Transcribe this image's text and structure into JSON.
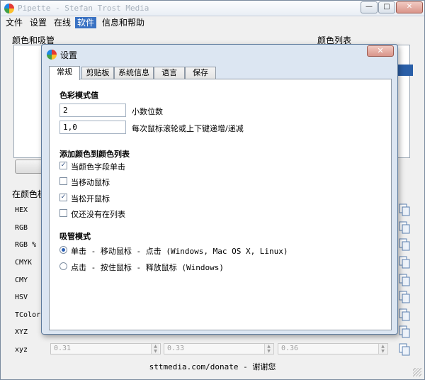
{
  "window": {
    "title": "Pipette - Stefan Trost Media",
    "controls": {
      "minimize": "—",
      "maximize": "□",
      "close": "✕"
    }
  },
  "menu": {
    "items": [
      "文件",
      "设置",
      "在线",
      "软件",
      "信息和帮助"
    ],
    "active_index": 3
  },
  "main": {
    "color_group_label": "颜色和吸管",
    "color_list_label": "颜色列表",
    "values_group_label": "在颜色模",
    "formats": [
      "HEX",
      "RGB",
      "RGB %",
      "CMYK",
      "CMY",
      "HSV",
      "TColor",
      "XYZ",
      "xyz"
    ],
    "xyz_values": [
      "0.31",
      "0.33",
      "0.36"
    ],
    "footer": "sttmedia.com/donate - 谢谢您"
  },
  "settings_dialog": {
    "title": "设置",
    "close_label": "✕",
    "tabs": [
      "常规",
      "剪贴板",
      "系统信息",
      "语言",
      "保存"
    ],
    "selected_tab": 0,
    "color_mode": {
      "heading": "色彩模式值",
      "decimals_value": "2",
      "decimals_label": "小数位数",
      "step_value": "1,0",
      "step_label": "每次鼠标滚轮或上下键递增/递减"
    },
    "add_to_list": {
      "heading": "添加颜色到颜色列表",
      "options": [
        {
          "label": "当颜色字段单击",
          "checked": true
        },
        {
          "label": "当移动鼠标",
          "checked": false
        },
        {
          "label": "当松开鼠标",
          "checked": true
        },
        {
          "label": "仅还没有在列表",
          "checked": false
        }
      ]
    },
    "pipette_mode": {
      "heading": "吸管模式",
      "options": [
        {
          "label": "单击 - 移动鼠标 - 点击 (Windows, Mac OS X, Linux)",
          "selected": true
        },
        {
          "label": "点击 - 按住鼠标 - 释放鼠标 (Windows)",
          "selected": false
        }
      ]
    }
  },
  "icons": {
    "app": "pipette-app-icon",
    "copy": "copy-icon",
    "check": "check-icon"
  },
  "colors": {
    "menu_active": "#3a72c3",
    "dialog_frame": "#dce6f2",
    "selection": "#2a5fa8"
  }
}
